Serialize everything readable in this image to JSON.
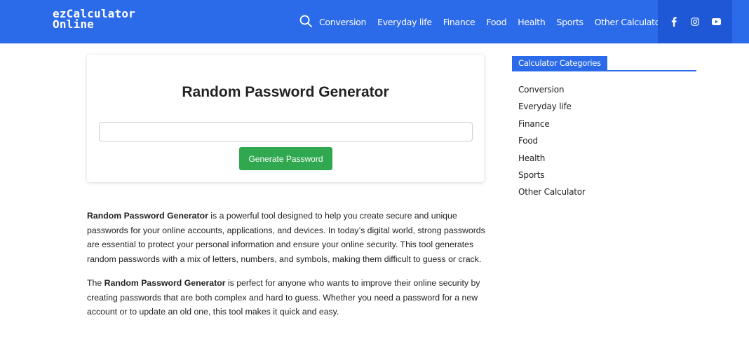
{
  "header": {
    "logo_line1": "ezCalculator",
    "logo_line2": "Online",
    "nav": [
      "Conversion",
      "Everyday life",
      "Finance",
      "Food",
      "Health",
      "Sports",
      "Other Calculator"
    ],
    "social_icons": [
      "facebook-icon",
      "instagram-icon",
      "youtube-icon"
    ],
    "brand_color": "#2b6ae8"
  },
  "calculator": {
    "title": "Random Password Generator",
    "password_value": "",
    "button_label": "Generate Password",
    "button_color": "#2fa84f"
  },
  "article": {
    "p1_bold": "Random Password Generator",
    "p1_rest": " is a powerful tool designed to help you create secure and unique passwords for your online accounts, applications, and devices. In today’s digital world, strong passwords are essential to protect your personal information and ensure your online security. This tool generates random passwords with a mix of letters, numbers, and symbols, making them difficult to guess or crack.",
    "p2_pre": "The ",
    "p2_bold": "Random Password Generator",
    "p2_rest": " is perfect for anyone who wants to improve their online security by creating passwords that are both complex and hard to guess. Whether you need a password for a new account or to update an old one, this tool makes it quick and easy."
  },
  "sidebar": {
    "heading": "Calculator Categories",
    "items": [
      "Conversion",
      "Everyday life",
      "Finance",
      "Food",
      "Health",
      "Sports",
      "Other Calculator"
    ]
  }
}
